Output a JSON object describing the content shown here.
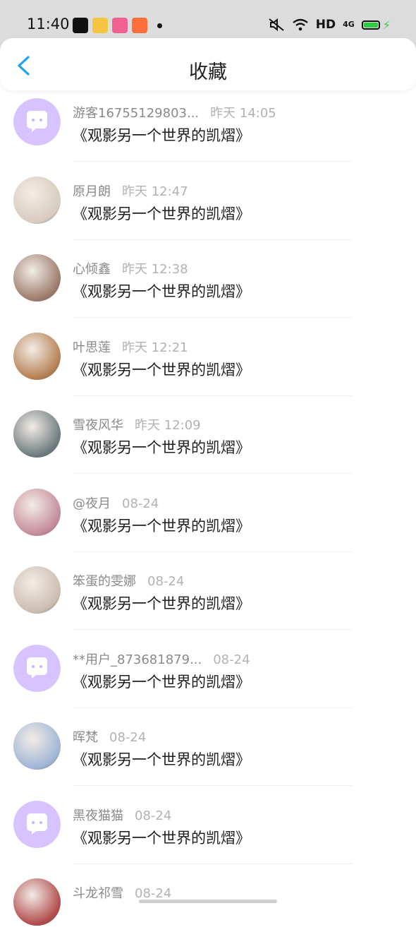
{
  "status_bar": {
    "time": "11:40",
    "hd_label": "HD",
    "network_label": "4G"
  },
  "header": {
    "title": "收藏",
    "back_icon": "chevron-left-icon",
    "accent": "#1da1f2"
  },
  "items": [
    {
      "name": "游客16755129803...",
      "time": "昨天 14:05",
      "content": "《观影另一个世界的凯熠》",
      "avatar": "bubble"
    },
    {
      "name": "原月朗",
      "time": "昨天 12:47",
      "content": "《观影另一个世界的凯熠》",
      "avatar": "photo"
    },
    {
      "name": "心倾鑫",
      "time": "昨天 12:38",
      "content": "《观影另一个世界的凯熠》",
      "avatar": "photo"
    },
    {
      "name": "叶思莲",
      "time": "昨天 12:21",
      "content": "《观影另一个世界的凯熠》",
      "avatar": "photo"
    },
    {
      "name": "雪夜风华",
      "time": "昨天 12:09",
      "content": "《观影另一个世界的凯熠》",
      "avatar": "photo"
    },
    {
      "name": "@夜月",
      "time": "08-24",
      "content": "《观影另一个世界的凯熠》",
      "avatar": "photo"
    },
    {
      "name": "笨蛋的雯娜",
      "time": "08-24",
      "content": "《观影另一个世界的凯熠》",
      "avatar": "photo"
    },
    {
      "name": "**用户_873681879...",
      "time": "08-24",
      "content": "《观影另一个世界的凯熠》",
      "avatar": "bubble"
    },
    {
      "name": "晖梵",
      "time": "08-24",
      "content": "《观影另一个世界的凯熠》",
      "avatar": "photo"
    },
    {
      "name": "黑夜猫猫",
      "time": "08-24",
      "content": "《观影另一个世界的凯熠》",
      "avatar": "bubble"
    },
    {
      "name": "斗龙祁雪",
      "time": "08-24",
      "content": "",
      "avatar": "photo"
    }
  ],
  "colors": {
    "bubble_avatar": "#d6c3ff",
    "status_bar_bg": "#dcdcdc"
  }
}
